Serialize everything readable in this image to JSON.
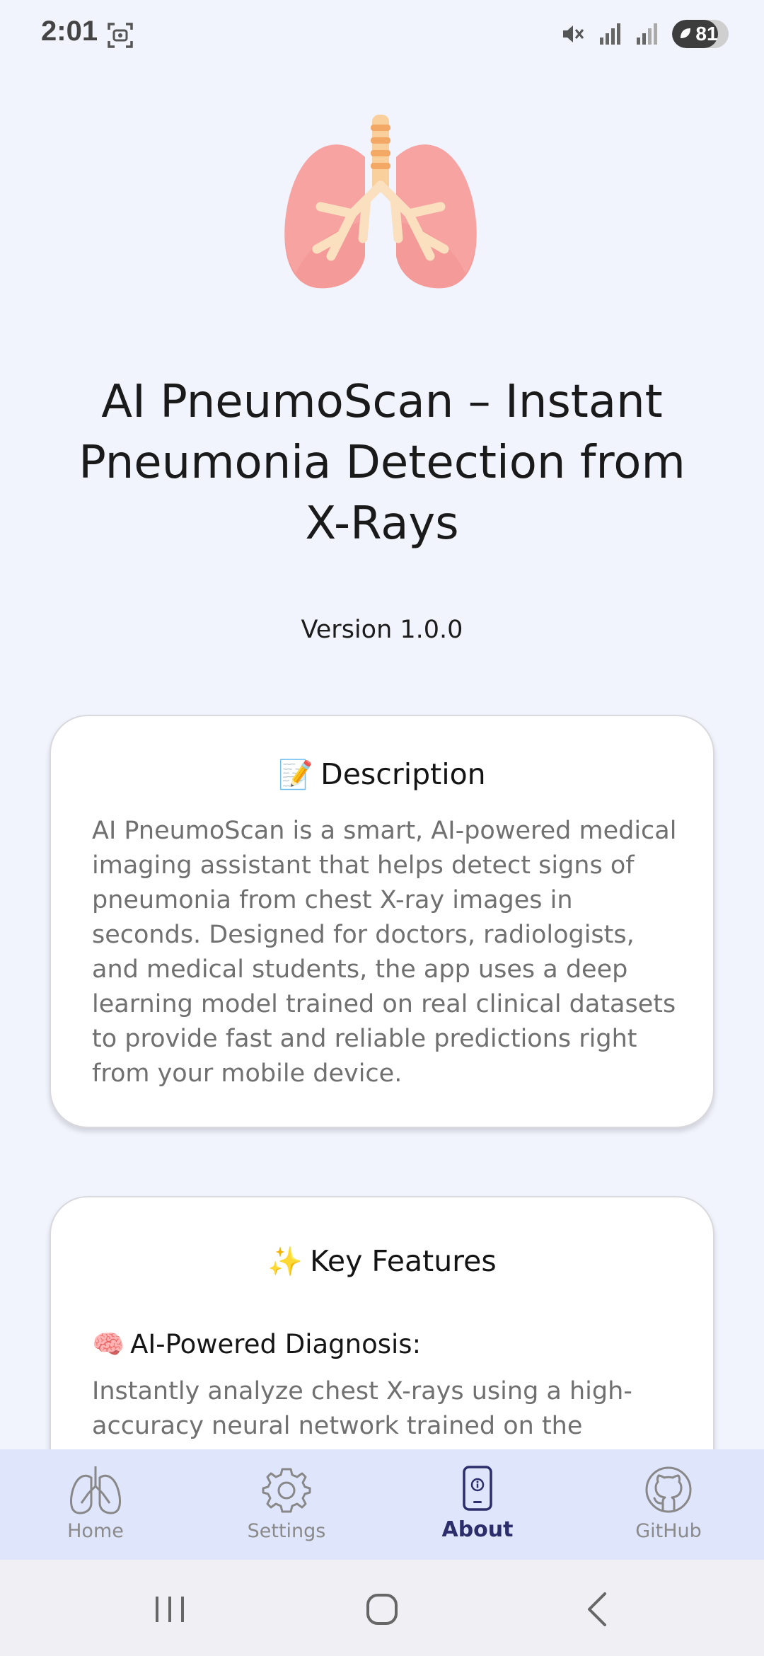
{
  "status": {
    "time": "2:01",
    "battery": "81",
    "battery_level": 0.81
  },
  "app": {
    "title": "AI PneumoScan – Instant Pneumonia Detection from X-Rays",
    "version": "Version 1.0.0"
  },
  "description": {
    "emoji": "📝",
    "title": "Description",
    "body": "AI PneumoScan is a smart, AI-powered medical imaging assistant that helps detect signs of pneumonia from chest X-ray images in seconds. Designed for doctors, radiologists, and medical students, the app uses a deep learning model trained on real clinical datasets to provide fast and reliable predictions right from your mobile device."
  },
  "features": {
    "emoji": "✨",
    "title": "Key Features",
    "items": [
      {
        "emoji": "🧠",
        "title": "AI-Powered Diagnosis:",
        "body": "Instantly analyze chest X-rays using a high-accuracy neural network trained on the publicly available NIH X-ray dataset."
      }
    ]
  },
  "nav": {
    "items": [
      {
        "label": "Home",
        "icon": "lungs-icon",
        "active": false
      },
      {
        "label": "Settings",
        "icon": "gear-icon",
        "active": false
      },
      {
        "label": "About",
        "icon": "phone-info-icon",
        "active": true
      },
      {
        "label": "GitHub",
        "icon": "github-icon",
        "active": false
      }
    ]
  },
  "colors": {
    "background": "#f1f4fd",
    "nav_background": "#dfe5fb",
    "nav_active": "#2b2e6b",
    "nav_inactive": "#8a8a8a",
    "lung_pink": "#f28b8b",
    "trachea_orange": "#f6b57a"
  }
}
